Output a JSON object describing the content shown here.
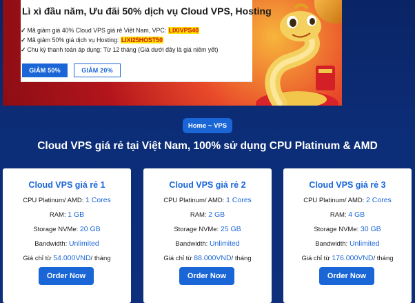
{
  "promo": {
    "title": "Lì xì đầu năm, Ưu đãi 50% dịch vụ Cloud VPS, Hosting",
    "lines": [
      {
        "text": "Mã giảm giá 40% Cloud VPS giá rẻ Việt Nam, VPC:",
        "code": "LIXIVPS40"
      },
      {
        "text": "Mã giảm 50% giá dịch vụ Hosting:",
        "code": "LIXI25HOST50"
      },
      {
        "text": "Chu kỳ thanh toán áp dụng: Từ 12 tháng  (Giá dưới đây là giá niêm yết)",
        "code": ""
      }
    ],
    "check_mark": "✓",
    "buttons": [
      {
        "label": "GIẢM 50%"
      },
      {
        "label": "GIẢM 20%"
      }
    ]
  },
  "breadcrumb": "Home ~ VPS",
  "heading": "Cloud VPS giá rẻ tại Việt Nam, 100% sử dụng CPU Platinum & AMD",
  "plans": [
    {
      "name": "Cloud VPS giá rẻ 1",
      "cpu_label": "CPU Platinum/ AMD:",
      "cpu": "1 Cores",
      "ram_label": "RAM:",
      "ram": "1 GB",
      "storage_label": "Storage NVMe:",
      "storage": "20 GB",
      "bandwidth_label": "Bandwidth:",
      "bandwidth": "Unlimited",
      "price_prefix": "Giá chỉ từ",
      "price": "54.000VND",
      "price_suffix": "/ tháng",
      "order_label": "Order Now"
    },
    {
      "name": "Cloud VPS giá rẻ 2",
      "cpu_label": "CPU Platinum/ AMD:",
      "cpu": "1 Cores",
      "ram_label": "RAM:",
      "ram": "2 GB",
      "storage_label": "Storage NVMe:",
      "storage": "25 GB",
      "bandwidth_label": "Bandwidth:",
      "bandwidth": "Unlimited",
      "price_prefix": "Giá chỉ từ",
      "price": "88.000VND",
      "price_suffix": "/ tháng",
      "order_label": "Order Now"
    },
    {
      "name": "Cloud VPS giá rẻ 3",
      "cpu_label": "CPU Platinum/ AMD:",
      "cpu": "2 Cores",
      "ram_label": "RAM:",
      "ram": "4 GB",
      "storage_label": "Storage NVMe:",
      "storage": "30 GB",
      "bandwidth_label": "Bandwidth:",
      "bandwidth": "Unlimited",
      "price_prefix": "Giá chỉ từ",
      "price": "176.000VND",
      "price_suffix": "/ tháng",
      "order_label": "Order Now"
    }
  ],
  "colors": {
    "accent": "#1a66d6",
    "background": "#0c2d78",
    "code_highlight": "#ffe100",
    "code_text": "#d10a0a"
  }
}
